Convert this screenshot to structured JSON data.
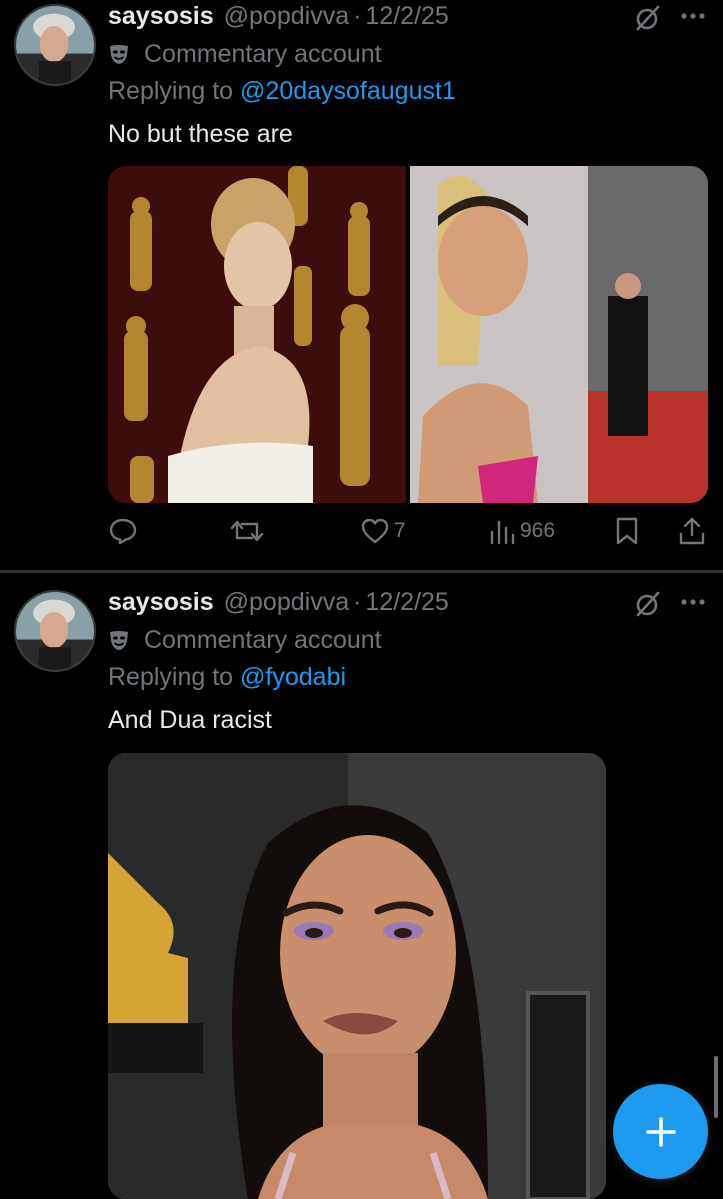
{
  "posts": [
    {
      "display_name": "saysosis",
      "handle": "@popdivva",
      "separator": "·",
      "date": "12/2/25",
      "account_label": "Commentary account",
      "replying_prefix": "Replying to",
      "replying_to": "@20daysofaugust1",
      "text": "No but these are",
      "actions": {
        "likes": "7",
        "views": "966"
      }
    },
    {
      "display_name": "saysosis",
      "handle": "@popdivva",
      "separator": "·",
      "date": "12/2/25",
      "account_label": "Commentary account",
      "replying_prefix": "Replying to",
      "replying_to": "@fyodabi",
      "text": "And Dua racist"
    }
  ],
  "icons": {
    "account_badge": "mask-icon",
    "grok": "grok-icon",
    "more": "more-icon",
    "reply": "reply-icon",
    "repost": "repost-icon",
    "like": "heart-icon",
    "views": "views-icon",
    "bookmark": "bookmark-icon",
    "share": "share-icon",
    "compose": "plus-icon"
  },
  "colors": {
    "background": "#000000",
    "text": "#e7e9ea",
    "muted": "#71767b",
    "accent": "#1d9bf0",
    "divider": "#2f3336"
  }
}
